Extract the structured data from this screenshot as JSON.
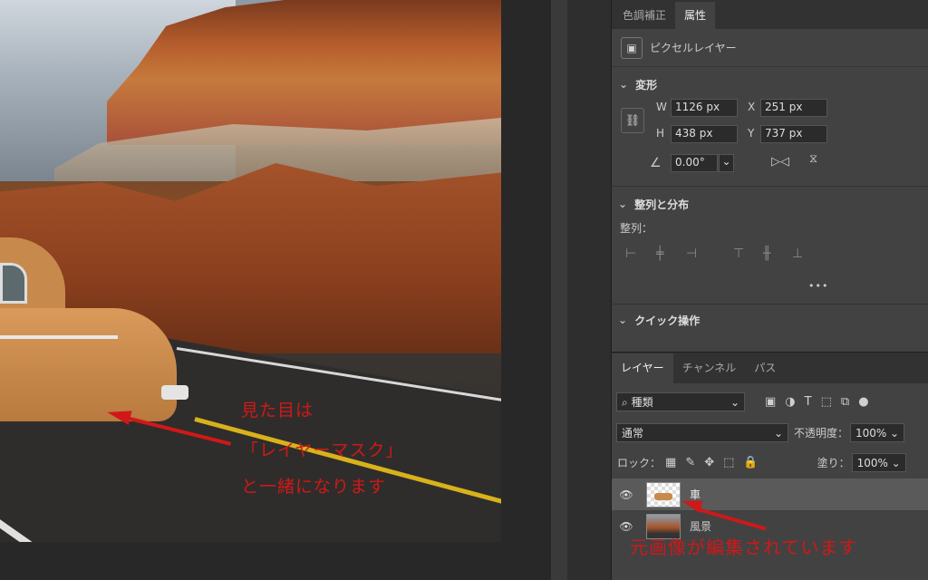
{
  "properties_panel": {
    "tabs": [
      "色調補正",
      "属性"
    ],
    "active_tab": "属性",
    "layer_type": "ピクセルレイヤー",
    "transform": {
      "heading": "変形",
      "w_label": "W",
      "w_value": "1126 px",
      "h_label": "H",
      "h_value": "438 px",
      "x_label": "X",
      "x_value": "251 px",
      "y_label": "Y",
      "y_value": "737 px",
      "angle_value": "0.00°"
    },
    "align": {
      "heading": "整列と分布",
      "sublabel": "整列：",
      "more": "•••"
    },
    "quick": {
      "heading": "クイック操作"
    }
  },
  "layers_panel": {
    "tabs": [
      "レイヤー",
      "チャンネル",
      "パス"
    ],
    "active_tab": "レイヤー",
    "filter_label": "種類",
    "blend_mode": "通常",
    "opacity_label": "不透明度：",
    "opacity_value": "100%",
    "lock_label": "ロック：",
    "fill_label": "塗り：",
    "fill_value": "100%",
    "layers": [
      {
        "name": "車",
        "selected": true
      },
      {
        "name": "風景",
        "selected": false
      }
    ]
  },
  "annotations": {
    "canvas_note_line1": "見た目は",
    "canvas_note_line2": "「レイヤーマスク」",
    "canvas_note_line3": "と一緒になります",
    "layers_note": "元画像が編集されています",
    "color": "#d01818"
  },
  "icons": {
    "chevron": "chevron-down-icon",
    "eye": "eye-icon",
    "link": "link-icon"
  }
}
